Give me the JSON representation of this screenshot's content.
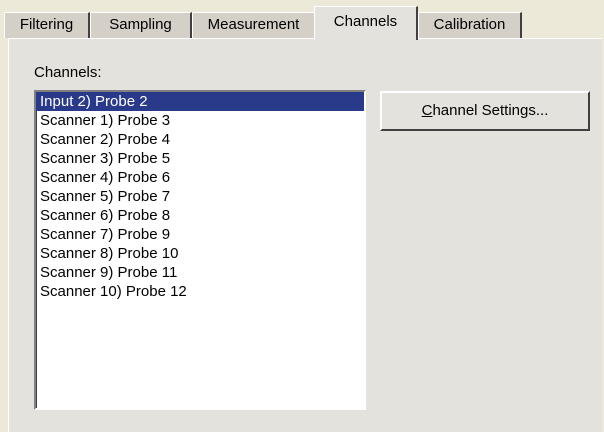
{
  "tabs": [
    {
      "label": "Filtering"
    },
    {
      "label": "Sampling"
    },
    {
      "label": "Measurement"
    },
    {
      "label": "Channels",
      "active": true
    },
    {
      "label": "Calibration"
    }
  ],
  "channels_label": "Channels:",
  "channel_list": [
    {
      "label": "Input 2) Probe 2",
      "selected": true
    },
    {
      "label": "Scanner 1) Probe 3"
    },
    {
      "label": "Scanner 2) Probe 4"
    },
    {
      "label": "Scanner 3) Probe 5"
    },
    {
      "label": "Scanner 4) Probe 6"
    },
    {
      "label": "Scanner 5) Probe 7"
    },
    {
      "label": "Scanner 6) Probe 8"
    },
    {
      "label": "Scanner 7) Probe 9"
    },
    {
      "label": "Scanner 8) Probe 10"
    },
    {
      "label": "Scanner 9) Probe 11"
    },
    {
      "label": "Scanner 10) Probe 12"
    }
  ],
  "channel_settings_button": {
    "mnemonic": "C",
    "rest": "hannel Settings..."
  },
  "colors": {
    "selection": "#2a3a8a",
    "face": "#d4d0c8"
  }
}
